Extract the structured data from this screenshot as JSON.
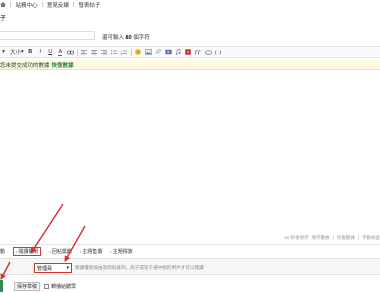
{
  "breadcrumb": {
    "items": [
      "站務中心",
      "意見反饋",
      "發表帖子"
    ],
    "separator": "|"
  },
  "page_title": "子",
  "subject": {
    "value": "",
    "remaining_prefix": "還可輸入",
    "remaining_count": "80",
    "remaining_suffix": "個字符"
  },
  "toolbar": {
    "font_label": "大小",
    "font_caret": "▾",
    "bold": "B",
    "italic": "I",
    "underline": "U",
    "font_color": "A"
  },
  "notice": {
    "text": "您未提交成功的數據",
    "link_label": "恢復數據"
  },
  "editor_status": {
    "autosave": "20 秒後保存",
    "save_now": "保存數據",
    "restore": "恢復數據",
    "word_count": "字數檢查"
  },
  "tabs": {
    "items": [
      {
        "label": "動"
      },
      {
        "label": "閱讀權限"
      },
      {
        "label": "回帖獎勵"
      },
      {
        "label": "主題售價"
      },
      {
        "label": "主題標簽"
      }
    ]
  },
  "permission": {
    "selected": "管理員",
    "hint": "閱讀權限按由高到低排列，高于或等于選中組的用戶才可以閱讀"
  },
  "bottom": {
    "draft_button": "保存草稿",
    "sync_label": "轉播給聽眾"
  },
  "colors": {
    "accent_green": "#2e8b57",
    "annotation_red": "#d32f2f"
  }
}
